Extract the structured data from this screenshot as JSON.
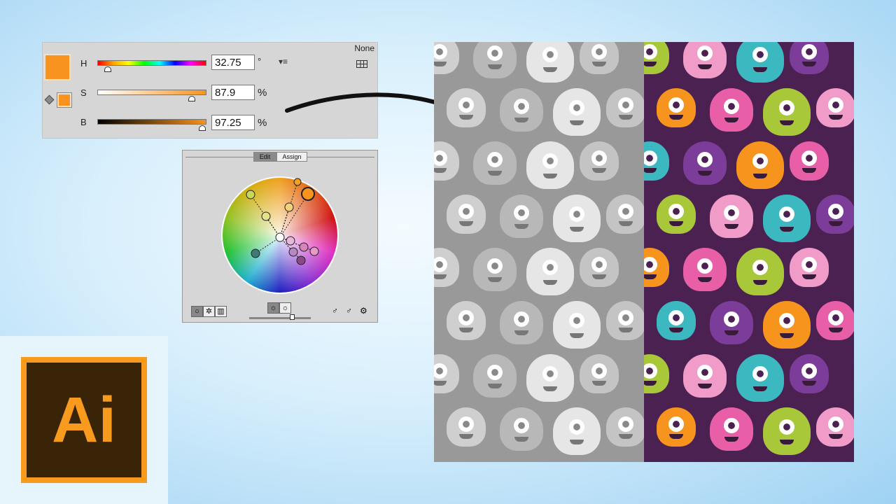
{
  "color_panel": {
    "none_label": "None",
    "swatch_color": "#f7931e",
    "rows": [
      {
        "label": "H",
        "value": "32.75",
        "unit": "°",
        "fraction": 0.091
      },
      {
        "label": "S",
        "value": "87.9",
        "unit": "%",
        "fraction": 0.879
      },
      {
        "label": "B",
        "value": "97.25",
        "unit": "%",
        "fraction": 0.9725
      }
    ],
    "menu_icon": "dropdown-list-icon",
    "grid_icon": "swatch-grid-icon"
  },
  "color_wheel": {
    "tabs": [
      {
        "label": "Edit",
        "active": true
      },
      {
        "label": "Assign",
        "active": false
      }
    ],
    "brightness_slider_fraction": 0.72,
    "nodes_colors": [
      "#f7931e",
      "#f0a020",
      "#f3d27a",
      "#c8d85a",
      "#e6e28a",
      "#ffffff",
      "#3f7a78",
      "#e8b8d8",
      "#d884b8",
      "#e89ac8",
      "#b888c0",
      "#8a4a8a"
    ]
  },
  "logo": {
    "text": "Ai",
    "accent": "#f79a1e"
  },
  "patterns": {
    "gray_colors": [
      "#cfcfcf",
      "#b8b8b8",
      "#e6e6e6",
      "#c4c4c4"
    ],
    "color_colors": [
      "#a8c83a",
      "#f19bc8",
      "#3bb8c0",
      "#7b3c9a",
      "#f7941e",
      "#e85fa8"
    ]
  }
}
